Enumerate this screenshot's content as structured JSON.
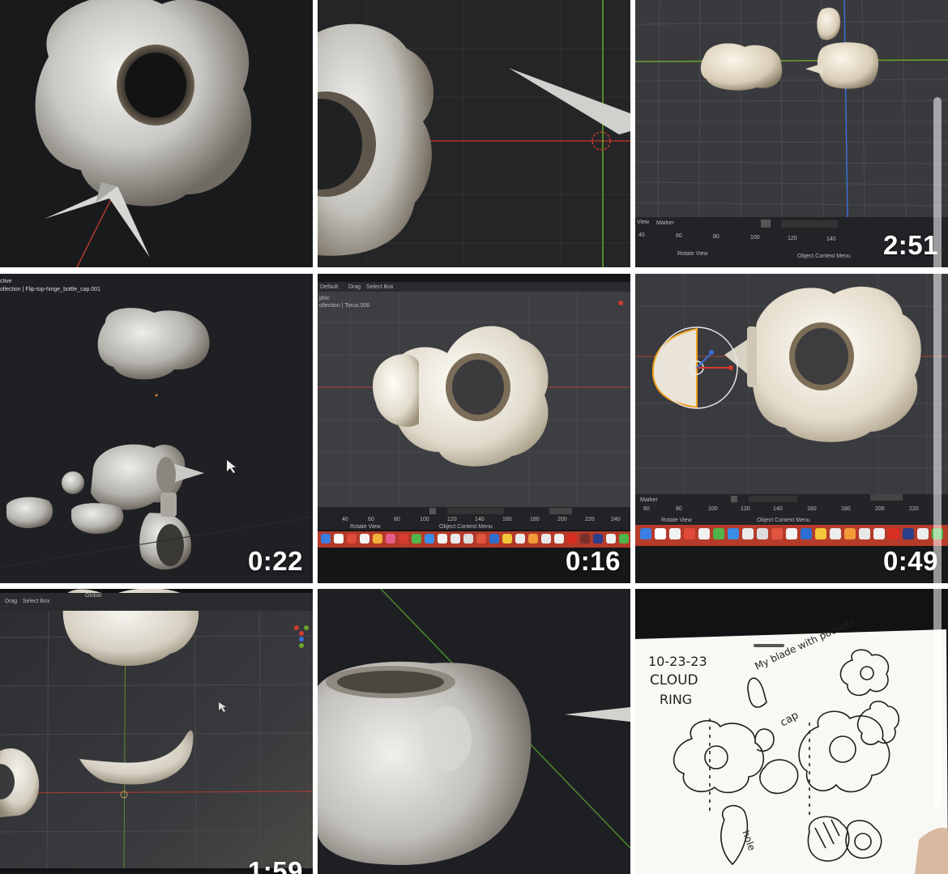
{
  "grid": {
    "tiles": [
      {
        "id": "t1",
        "duration": ""
      },
      {
        "id": "t2",
        "duration": ""
      },
      {
        "id": "t3",
        "duration": "2:51",
        "timeline_menu": [
          "View",
          "Marker"
        ],
        "timeline_ticks": [
          "40",
          "60",
          "80",
          "100",
          "120",
          "140"
        ],
        "status_items": [
          "Rotate View",
          "Object Context Menu"
        ]
      },
      {
        "id": "t4",
        "duration": "0:22",
        "viewport_caption": [
          "ctive",
          "ollection | Flip-top-hinge_bottle_cap.001"
        ]
      },
      {
        "id": "t5",
        "duration": "0:16",
        "header_items": [
          "Default",
          "Drag",
          "Select Box"
        ],
        "viewport_caption": [
          "phic",
          "ollection | Torus.006"
        ],
        "timeline_ticks": [
          "40",
          "60",
          "80",
          "100",
          "120",
          "140",
          "160",
          "180",
          "200",
          "220",
          "240"
        ],
        "status_items": [
          "Rotate View",
          "Object Context Menu"
        ]
      },
      {
        "id": "t6",
        "duration": "0:49",
        "timeline_menu": [
          "Marker"
        ],
        "timeline_ticks": [
          "60",
          "80",
          "100",
          "120",
          "140",
          "160",
          "180",
          "200",
          "220"
        ],
        "status_items": [
          "Rotate View",
          "Object Context Menu"
        ]
      },
      {
        "id": "t7",
        "duration": "1:59",
        "header_items": [
          "Drag",
          "Select Box",
          "Global"
        ]
      },
      {
        "id": "t8",
        "duration": ""
      },
      {
        "id": "t9",
        "duration": "",
        "sketch_notes": [
          "10-23-23",
          "CLOUD",
          "RING",
          "My blade with pockets",
          "cap",
          "hole"
        ]
      }
    ]
  },
  "colors": {
    "background": "#ffffff",
    "tile_dark": "#1d1e21",
    "blender_grid": "#2a2a2a",
    "duration_text": "#ffffff",
    "x_axis": "#c0392b",
    "y_axis": "#6aa52b",
    "z_axis": "#3a6fd8",
    "selection_orange": "#f0a020"
  }
}
